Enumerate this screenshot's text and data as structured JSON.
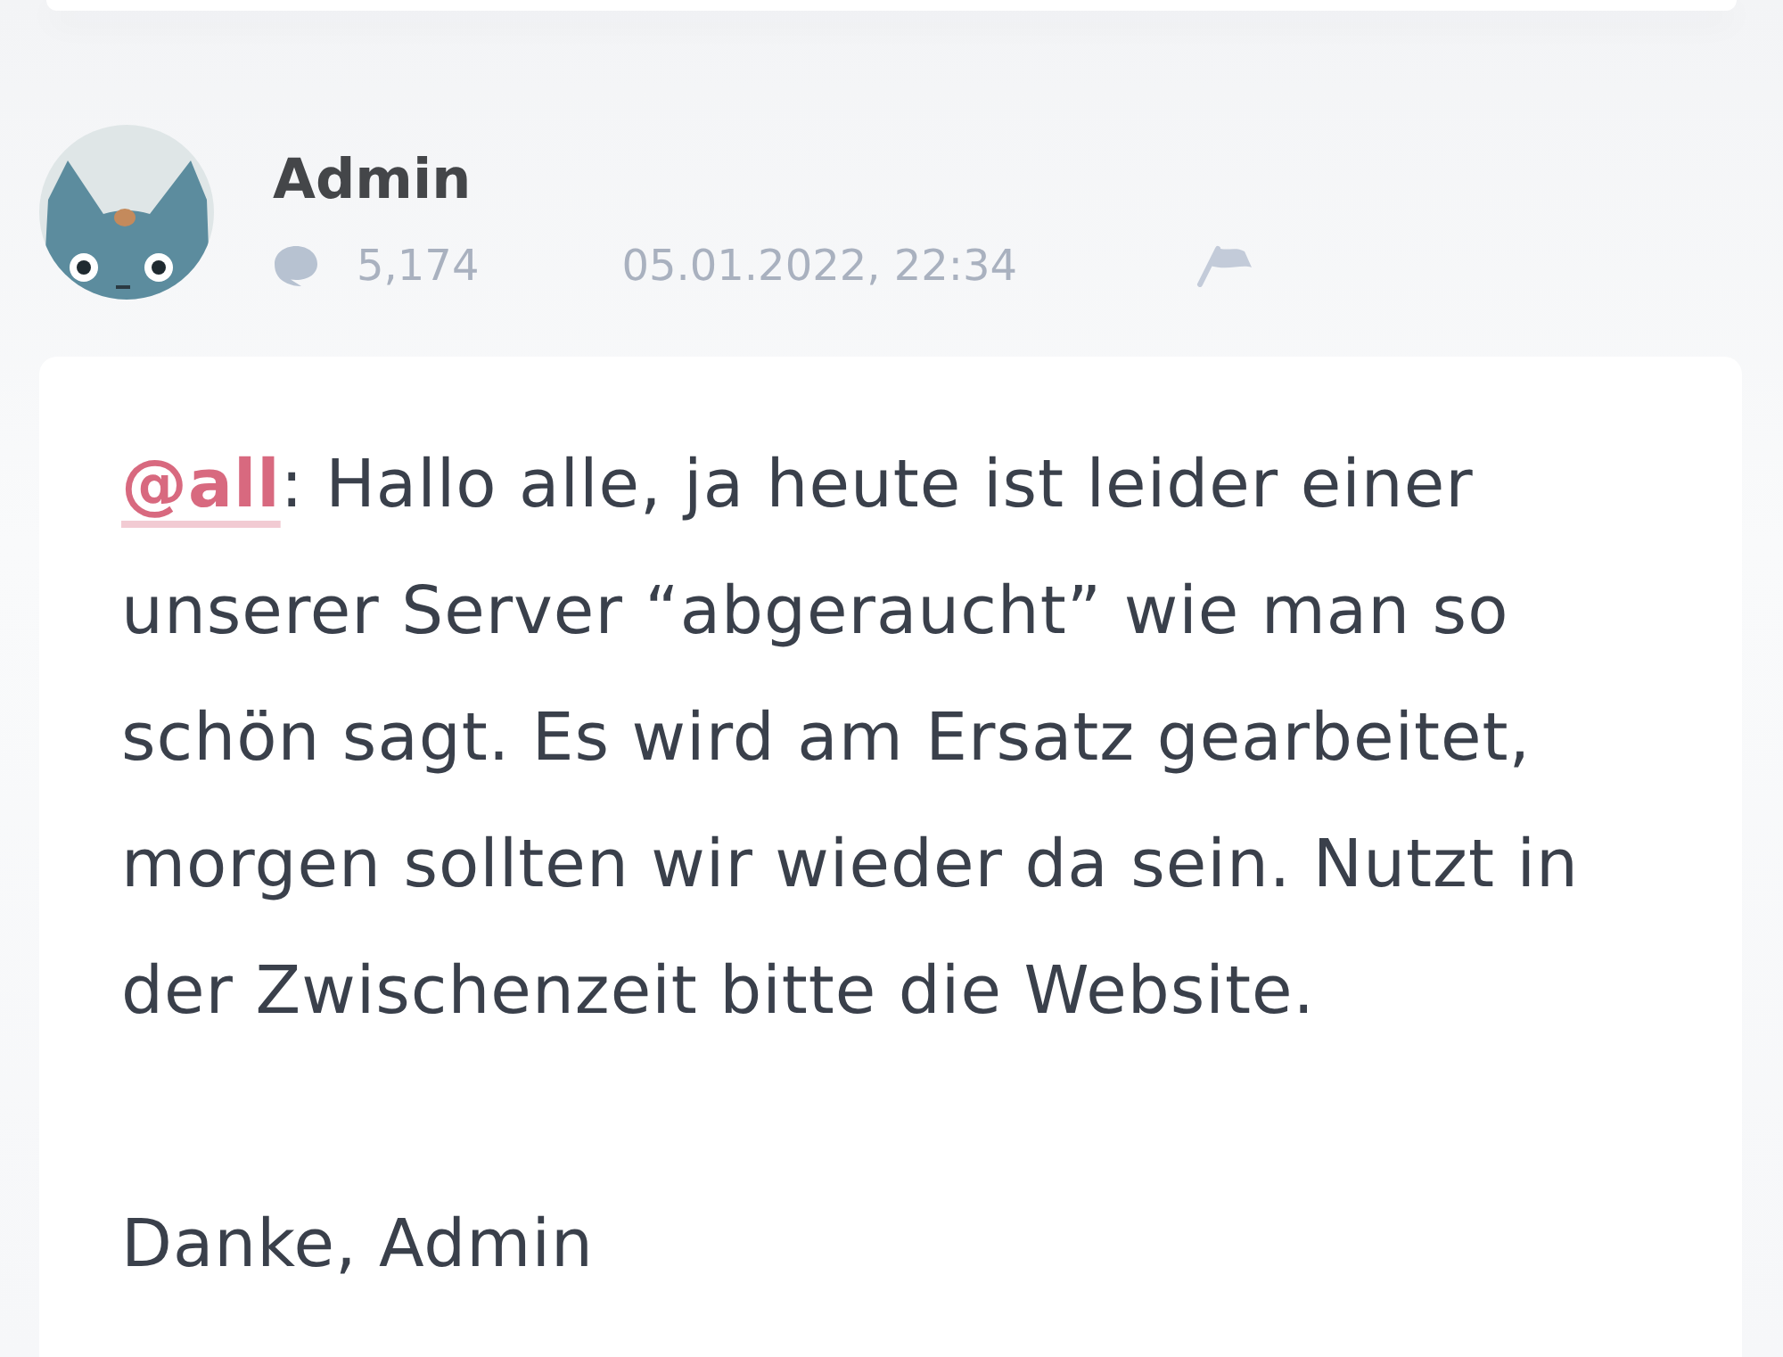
{
  "post": {
    "author": {
      "name": "Admin"
    },
    "post_count": "5,174",
    "timestamp": "05.01.2022, 22:34",
    "body": [
      {
        "mention": "@all",
        "text": ": Hallo alle, ja heute ist leider einer unserer Server “abgeraucht” wie man so schön sagt. Es wird am Ersatz gearbeitet, morgen sollten wir wieder da sein. Nutzt in der Zwischenzeit bitte die Website."
      },
      {
        "text": "Danke, Admin"
      }
    ]
  }
}
